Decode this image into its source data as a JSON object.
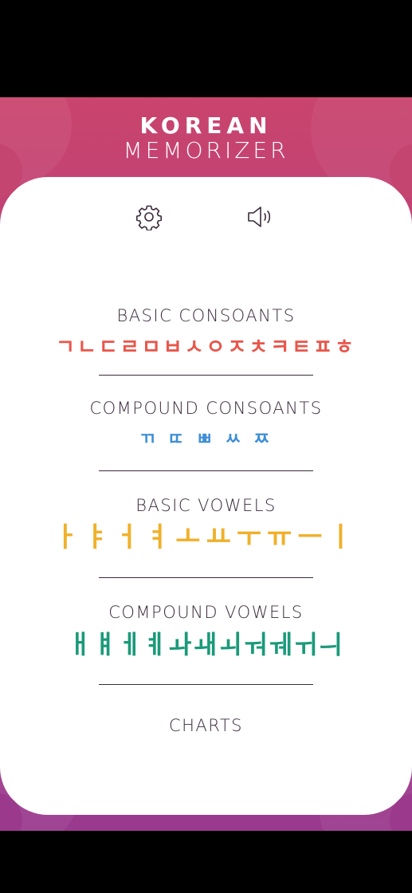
{
  "brand": {
    "line1": "KOREAN",
    "line2": "MEMORIZER"
  },
  "toolbar": {
    "settings_icon": "gear-icon",
    "sound_icon": "speaker-icon"
  },
  "sections": [
    {
      "title": "BASIC CONSOANTS",
      "letters": "ㄱㄴㄷㄹㅁㅂㅅㅇㅈㅊㅋㅌㅍㅎ",
      "color": "#e8564b"
    },
    {
      "title": "COMPOUND CONSOANTS",
      "letters": "ㄲ ㄸ ㅃ ㅆ ㅉ",
      "color": "#3f8fd6"
    },
    {
      "title": "BASIC VOWELS",
      "letters": "ㅏㅑㅓㅕㅗㅛㅜㅠㅡㅣ",
      "color": "#f0b02a"
    },
    {
      "title": "COMPOUND VOWELS",
      "letters": "ㅐㅒㅔㅖㅘㅙㅚㅝㅞㅟㅢ",
      "color": "#1a9a7a"
    },
    {
      "title": "CHARTS"
    }
  ],
  "colors": {
    "gradient_top": "#c9446e",
    "gradient_bottom": "#9a3a8e",
    "text": "#3b2a3c"
  }
}
